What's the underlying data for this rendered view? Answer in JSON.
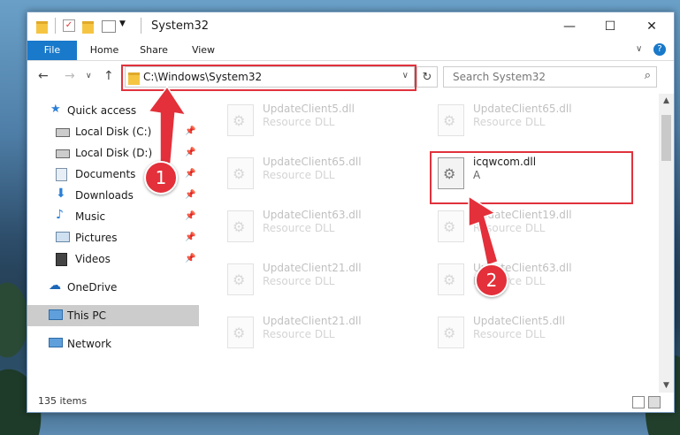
{
  "window": {
    "title": "System32"
  },
  "ribbon": {
    "tabs": [
      "File",
      "Home",
      "Share",
      "View"
    ]
  },
  "address": {
    "path": "C:\\Windows\\System32",
    "search_placeholder": "Search System32"
  },
  "sidebar": {
    "items": [
      {
        "label": "Quick access",
        "icon": "star-icon"
      },
      {
        "label": "Local Disk (C:)",
        "icon": "drive-icon"
      },
      {
        "label": "Local Disk (D:)",
        "icon": "drive-icon"
      },
      {
        "label": "Documents",
        "icon": "documents-icon"
      },
      {
        "label": "Downloads",
        "icon": "download-icon"
      },
      {
        "label": "Music",
        "icon": "music-icon"
      },
      {
        "label": "Pictures",
        "icon": "pictures-icon"
      },
      {
        "label": "Videos",
        "icon": "videos-icon"
      },
      {
        "label": "OneDrive",
        "icon": "cloud-icon"
      },
      {
        "label": "This PC",
        "icon": "computer-icon"
      },
      {
        "label": "Network",
        "icon": "network-icon"
      }
    ]
  },
  "files": [
    {
      "name": "UpdateClient5.dll",
      "type": "Resource DLL"
    },
    {
      "name": "UpdateClient65.dll",
      "type": "Resource DLL"
    },
    {
      "name": "UpdateClient65.dll",
      "type": "Resource DLL"
    },
    {
      "name": "icqwcom.dll",
      "type": "A"
    },
    {
      "name": "UpdateClient63.dll",
      "type": "Resource DLL"
    },
    {
      "name": "UpdateClient19.dll",
      "type": "Resource DLL"
    },
    {
      "name": "UpdateClient21.dll",
      "type": "Resource DLL"
    },
    {
      "name": "UpdateClient63.dll",
      "type": "Resource DLL"
    },
    {
      "name": "UpdateClient21.dll",
      "type": "Resource DLL"
    },
    {
      "name": "UpdateClient5.dll",
      "type": "Resource DLL"
    }
  ],
  "status": {
    "items_count": "135 items"
  },
  "annotations": {
    "badge1": "1",
    "badge2": "2"
  },
  "colors": {
    "accent": "#1979ca",
    "highlight": "#e0323c"
  }
}
